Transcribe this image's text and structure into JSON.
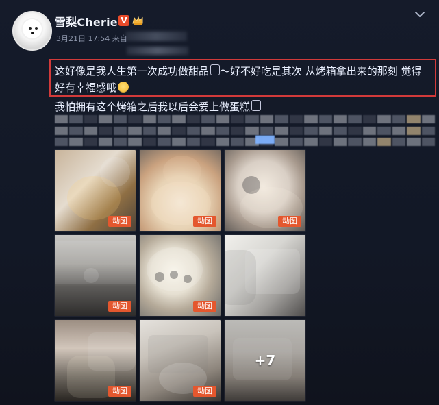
{
  "user": {
    "name": "雪梨Cherie",
    "badge_v": "V"
  },
  "post": {
    "meta": "3月21日 17:54 来自",
    "text": {
      "line1": "这好像是我人生第一次成功做甜品",
      "line1_tail": "～好不好吃是其次 从烤箱拿出来的那刻 觉得",
      "line2": "好有幸福感哦",
      "line3": "我怕拥有这个烤箱之后我以后会爱上做蛋糕"
    }
  },
  "images": {
    "tag": "动图",
    "more_count": "+7"
  },
  "colors": {
    "highlight_border": "#d23a3a",
    "tag_bg": "#e4572e",
    "link": "#7fb2ff"
  },
  "icons": {
    "verified": "verified-v-icon",
    "crown": "crown-icon",
    "chevron": "chevron-down-icon",
    "emoji": "emoji-icon",
    "small": "small-symbol-icon"
  }
}
